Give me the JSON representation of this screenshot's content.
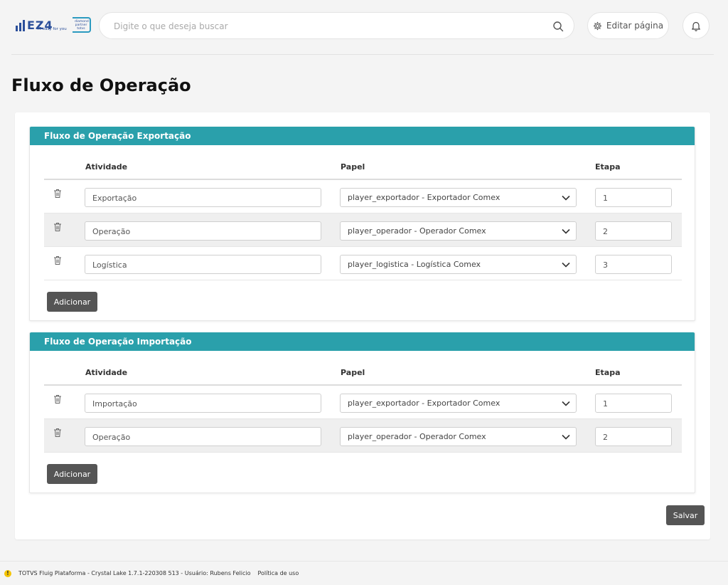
{
  "header": {
    "logo": {
      "mark": "EZ4",
      "tagline": "IT easy for you",
      "partner": "diamond partner totvs"
    },
    "search_placeholder": "Digite o que deseja buscar",
    "edit_page_label": "Editar página"
  },
  "page": {
    "title": "Fluxo de Operação"
  },
  "columns": {
    "activity": "Atividade",
    "role": "Papel",
    "step": "Etapa"
  },
  "panels": [
    {
      "title": "Fluxo de Operação Exportação",
      "rows": [
        {
          "activity": "Exportação",
          "role": "player_exportador - Exportador Comex",
          "step": "1"
        },
        {
          "activity": "Operação",
          "role": "player_operador - Operador Comex",
          "step": "2"
        },
        {
          "activity": "Logística",
          "role": "player_logistica - Logística Comex",
          "step": "3"
        }
      ],
      "add_label": "Adicionar"
    },
    {
      "title": "Fluxo de Operação Importação",
      "rows": [
        {
          "activity": "Importação",
          "role": "player_exportador - Exportador Comex",
          "step": "1"
        },
        {
          "activity": "Operação",
          "role": "player_operador - Operador Comex",
          "step": "2"
        }
      ],
      "add_label": "Adicionar"
    }
  ],
  "save_label": "Salvar",
  "footer": {
    "platform": "TOTVS Fluig Plataforma - Crystal Lake 1.7.1-220308 513 - Usuário: Rubens Felicio",
    "policy_link": "Política de uso"
  },
  "colors": {
    "panel_header": "#2aa0ab",
    "button": "#555555",
    "logo": "#2b4f9a",
    "warning": "#f5c400"
  }
}
